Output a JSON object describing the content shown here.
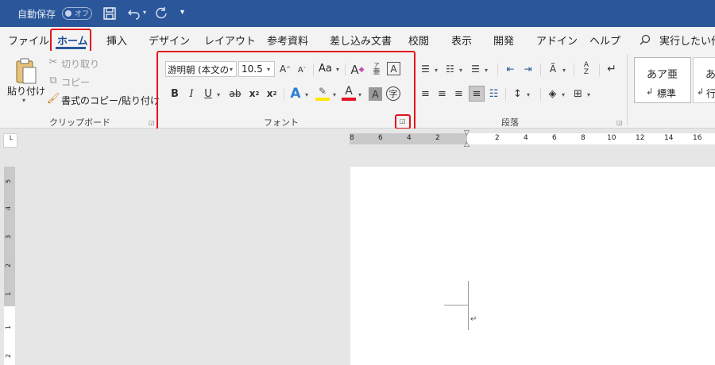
{
  "title_bar": {
    "autosave_label": "自動保存",
    "autosave_state": "オフ",
    "qat_more": "▾"
  },
  "tabs": [
    "ファイル",
    "ホーム",
    "挿入",
    "デザイン",
    "レイアウト",
    "参考資料",
    "差し込み文書",
    "校閲",
    "表示",
    "開発",
    "アドイン",
    "ヘルプ"
  ],
  "active_tab": "ホーム",
  "search": {
    "label": "実行したい作"
  },
  "clipboard": {
    "paste_label": "貼り付け",
    "cut_label": "切り取り",
    "copy_label": "コピー",
    "format_painter_label": "書式のコピー/貼り付け",
    "group_label": "クリップボード"
  },
  "font": {
    "font_name": "游明朝 (本文の",
    "font_size": "10.5",
    "case_label": "Aa",
    "group_label": "フォント"
  },
  "paragraph": {
    "group_label": "段落"
  },
  "styles": {
    "items": [
      {
        "preview": "あア亜",
        "name": "標準"
      },
      {
        "preview": "あ",
        "name": "行"
      }
    ]
  },
  "ruler": {
    "h_numbers": [
      "8",
      "6",
      "4",
      "2",
      "2",
      "4",
      "6",
      "8",
      "10",
      "12",
      "14",
      "16"
    ],
    "v_numbers": [
      "5",
      "4",
      "3",
      "2",
      "1",
      "1",
      "2"
    ]
  },
  "colors": {
    "title_bar": "#2b579a",
    "accent_red": "#e0151c",
    "highlight": "#ffe800",
    "font_color": "#e81123"
  }
}
